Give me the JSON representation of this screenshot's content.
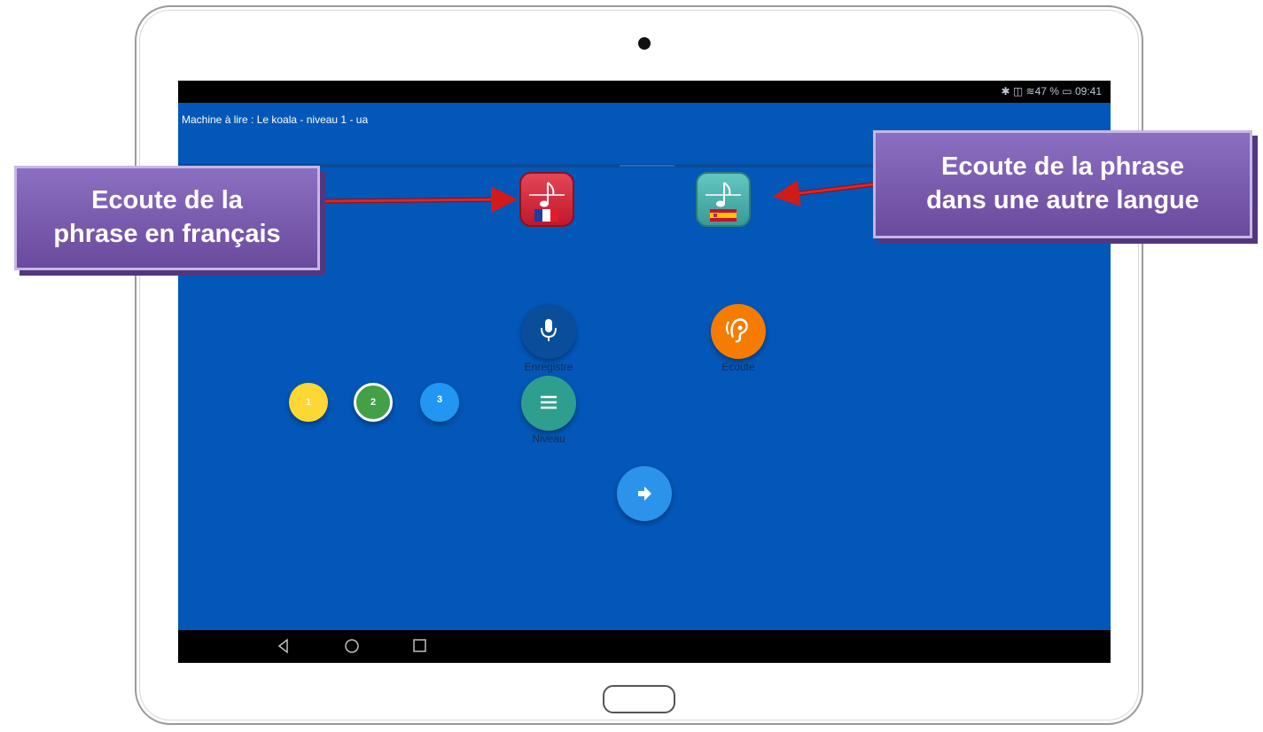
{
  "status_bar": {
    "text": "✱ ◫ ≋47 % ▭ 09:41"
  },
  "app": {
    "title": "Machine à lire : Le koala - niveau 1 - ua"
  },
  "buttons": {
    "music_french_flag_icon": "france-flag-icon",
    "music_spanish_flag_icon": "spain-flag-icon",
    "record_label": "Enregistre",
    "listen_label": "Ecoute",
    "level_label": "Niveau",
    "next_icon": "arrow-right-icon"
  },
  "levels": [
    "1",
    "2",
    "3"
  ],
  "annotations": {
    "left": [
      "Ecoute de la",
      "phrase en français"
    ],
    "right": [
      "Ecoute de la phrase",
      "dans une autre langue"
    ]
  },
  "colors": {
    "screen_bg": "#0357b8",
    "record_btn": "#0a4d9b",
    "listen_btn": "#f57c00",
    "level_btn": "#2e9f8e",
    "next_btn": "#2b94ea",
    "level1": "#fdd835",
    "level2": "#43a047",
    "level3": "#2196f3",
    "callout": "#7b5cb3"
  }
}
